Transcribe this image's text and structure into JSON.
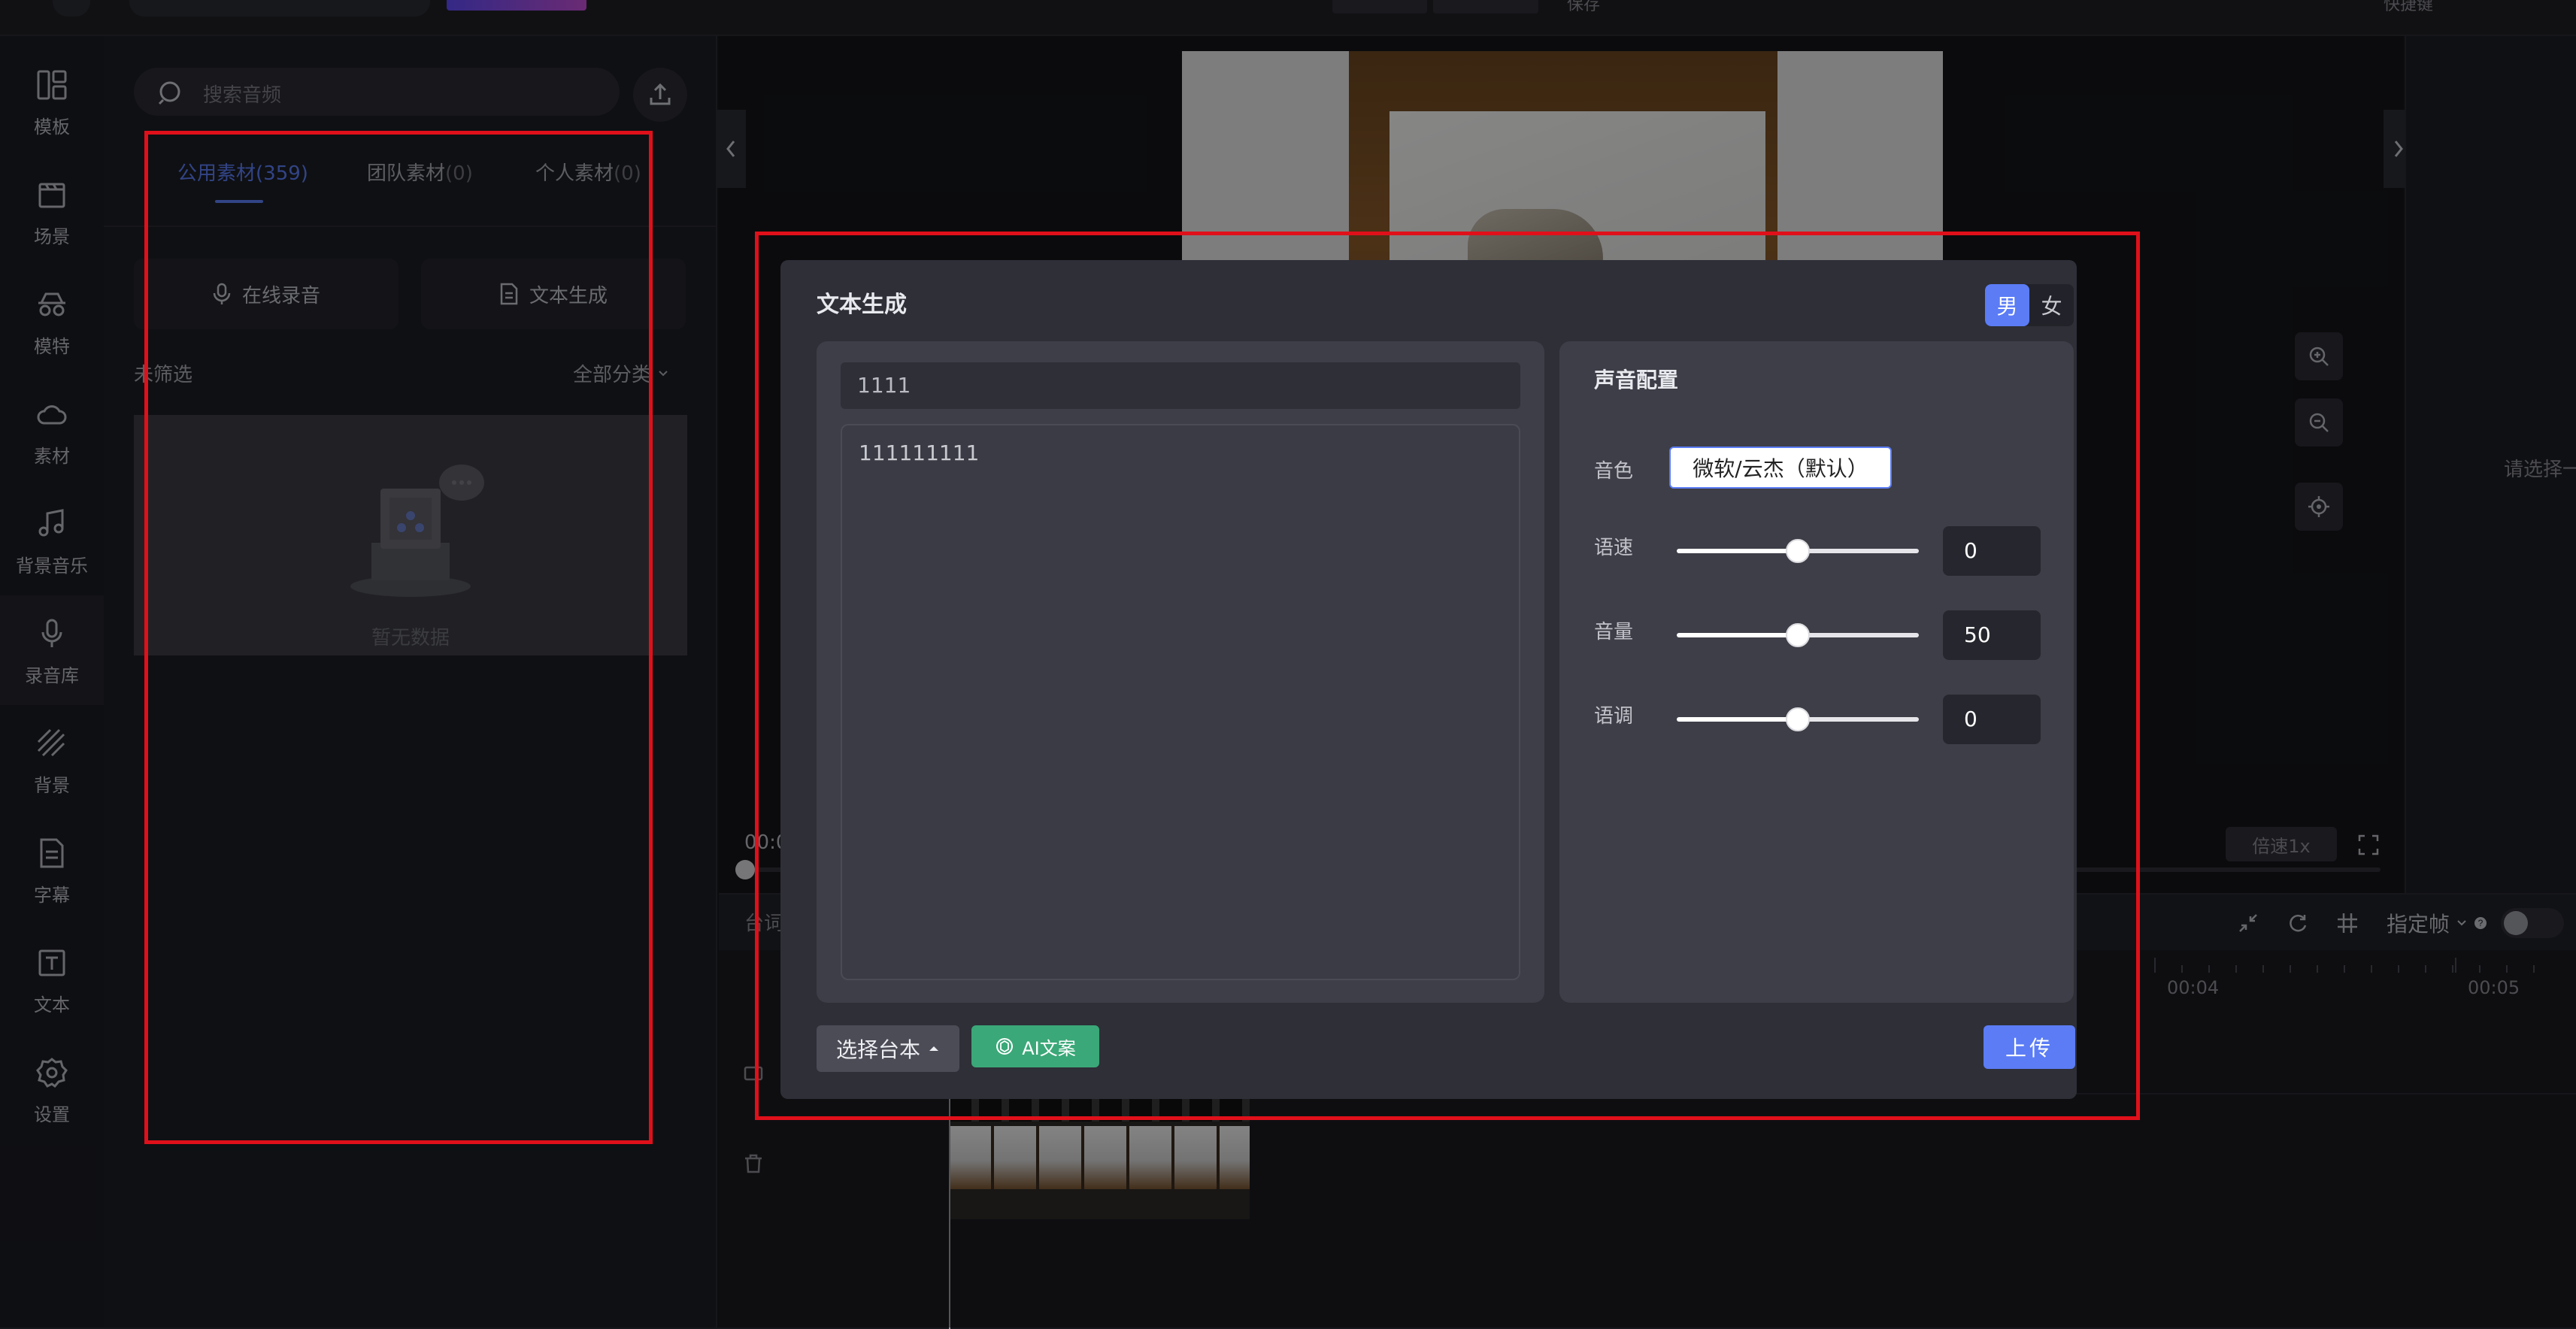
{
  "topbar": {
    "save_label": "保存",
    "shortcut_label": "快捷键"
  },
  "rail": {
    "items": [
      {
        "label": "模板",
        "icon": "template-icon"
      },
      {
        "label": "场景",
        "icon": "scene-icon"
      },
      {
        "label": "模特",
        "icon": "model-icon"
      },
      {
        "label": "素材",
        "icon": "cloud-icon"
      },
      {
        "label": "背景音乐",
        "icon": "music-icon"
      },
      {
        "label": "录音库",
        "icon": "microphone-icon"
      },
      {
        "label": "背景",
        "icon": "background-icon"
      },
      {
        "label": "字幕",
        "icon": "subtitle-icon"
      },
      {
        "label": "文本",
        "icon": "text-icon"
      },
      {
        "label": "设置",
        "icon": "gear-icon"
      }
    ],
    "active_index": 5
  },
  "panel": {
    "search_placeholder": "搜索音频",
    "tabs": [
      {
        "label": "公用素材",
        "count": "(359)"
      },
      {
        "label": "团队素材",
        "count": "(0)"
      },
      {
        "label": "个人素材",
        "count": "(0)"
      }
    ],
    "record_label": "在线录音",
    "text_gen_label": "文本生成",
    "filter_label": "未筛选",
    "category_label": "全部分类",
    "empty_label": "暂无数据"
  },
  "preview": {
    "time_label": "00:0",
    "speed_label": "倍速1x",
    "hint": "请选择一"
  },
  "timeline": {
    "tab_label": "台词",
    "specify_label": "指定帧",
    "tick_labels": [
      "00:04",
      "00:05"
    ]
  },
  "modal": {
    "title": "文本生成",
    "gender": {
      "male": "男",
      "female": "女",
      "selected": "男"
    },
    "title_value": "1111",
    "body_value": "111111111",
    "voice_config_title": "声音配置",
    "timbre_label": "音色",
    "timbre_value": "微软/云杰（默认）",
    "sliders": [
      {
        "label": "语速",
        "value": "0",
        "level": 0.5
      },
      {
        "label": "音量",
        "value": "50",
        "level": 0.5
      },
      {
        "label": "语调",
        "value": "0",
        "level": 0.5
      }
    ],
    "select_script_label": "选择台本",
    "ai_label": "AI文案",
    "upload_label": "上传"
  },
  "colors": {
    "accent": "#5b7cf5",
    "ai_green": "#3aa878",
    "annotation_red": "#e0101a"
  }
}
